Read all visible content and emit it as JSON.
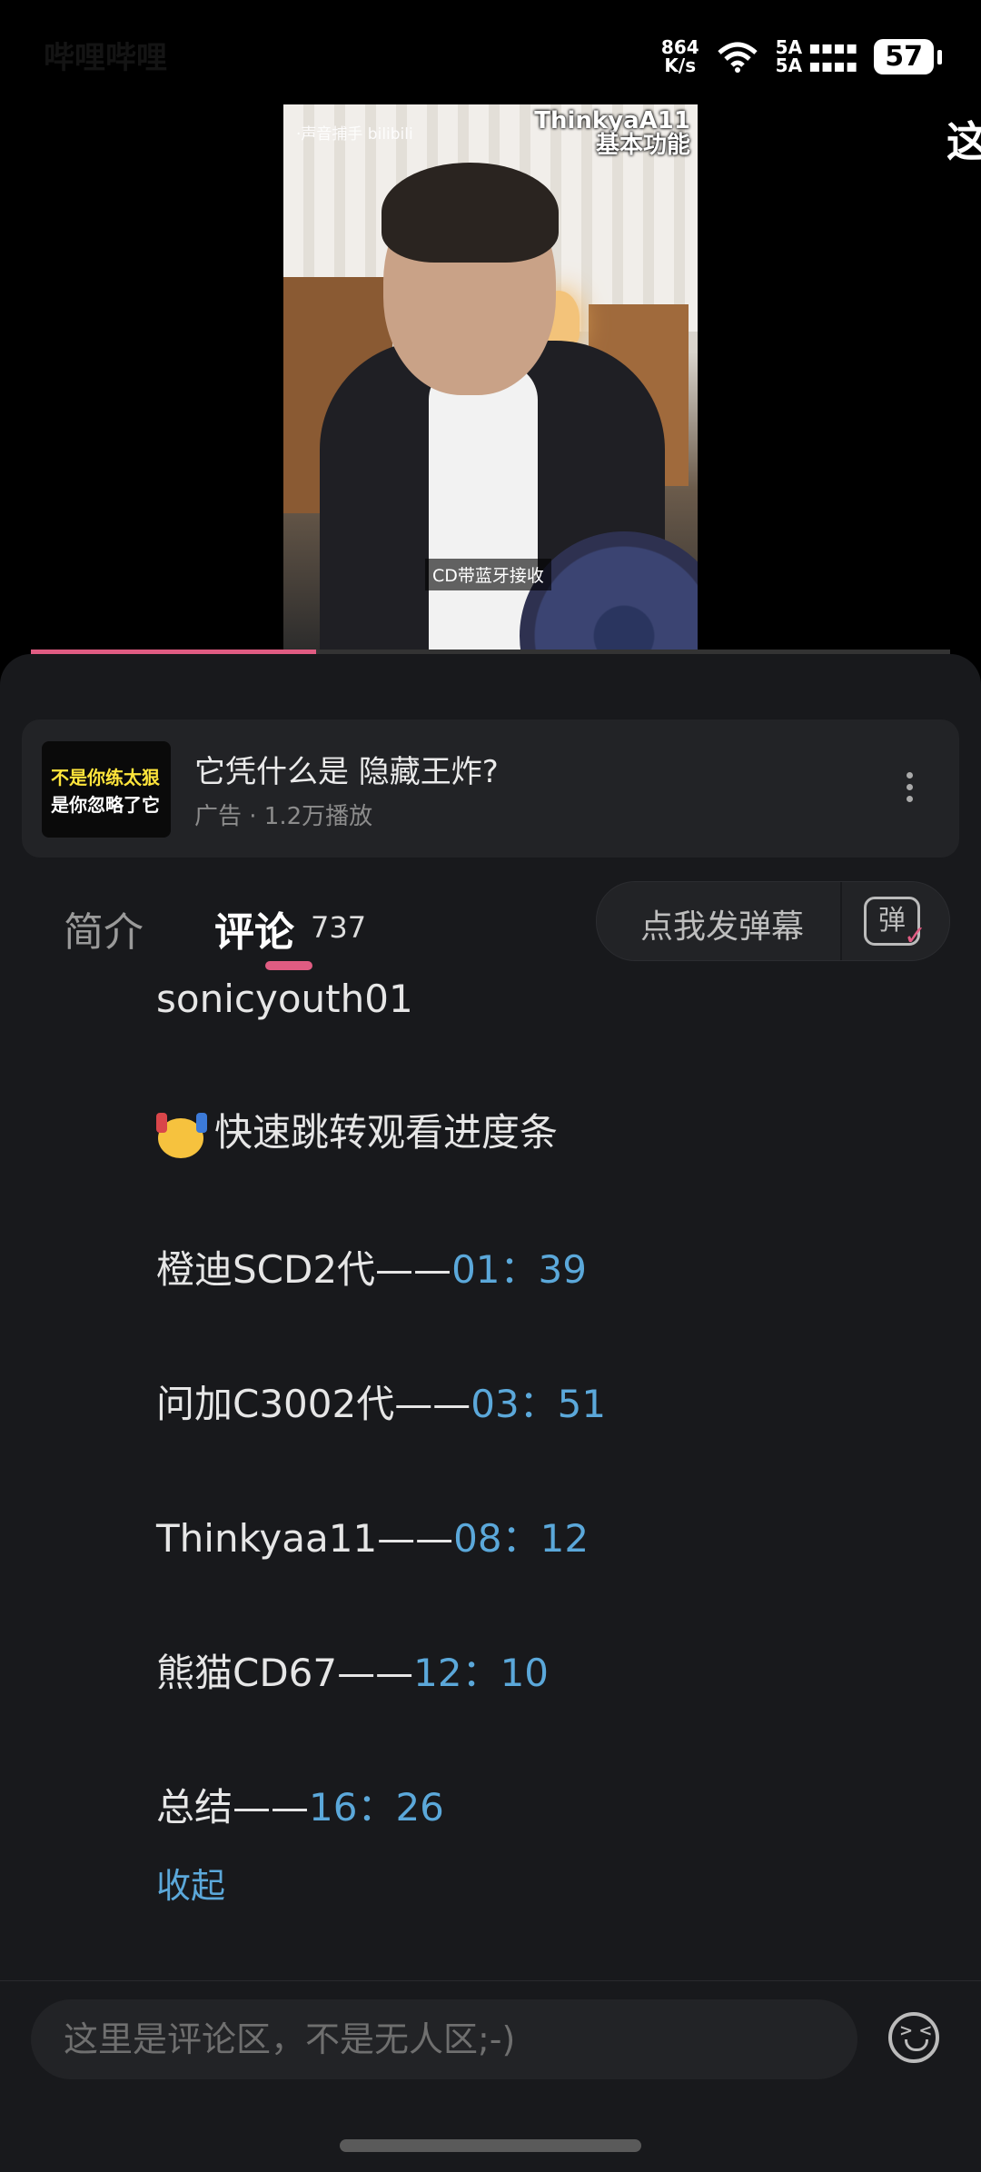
{
  "status_bar": {
    "app_label": "哔哩哔哩",
    "net_speed_value": "864",
    "net_speed_unit": "K/s",
    "signal_1": "5A",
    "signal_2": "5A",
    "battery": "57"
  },
  "video": {
    "watermark": "·声音捕手 bilibili",
    "title_line1": "ThinkyaA11",
    "title_line2": "基本功能",
    "subtitle": "CD带蓝牙接收",
    "side_glyph": "这",
    "progress_fraction": 0.31
  },
  "ad": {
    "thumb_line1": "不是你练太狠",
    "thumb_line2": "是你忽略了它",
    "title": "它凭什么是 隐藏王炸?",
    "meta": "广告 · 1.2万播放"
  },
  "tabs": {
    "intro": "简介",
    "comments": "评论",
    "comment_count": "737",
    "danmaku_placeholder": "点我发弹幕",
    "danmaku_icon": "弹"
  },
  "comment": {
    "username": "sonicyouth01",
    "header_text": "快速跳转观看进度条",
    "items": [
      {
        "label": "橙迪SCD2代——",
        "time": "01：39"
      },
      {
        "label": "问加C3002代——",
        "time": "03：51"
      },
      {
        "label": "Thinkyaa11——",
        "time": "08：12"
      },
      {
        "label": "熊猫CD67——",
        "time": "12：10"
      },
      {
        "label": "总结——",
        "time": "16：26"
      }
    ],
    "collapse": "收起"
  },
  "input": {
    "placeholder": "这里是评论区，不是无人区;-)"
  }
}
